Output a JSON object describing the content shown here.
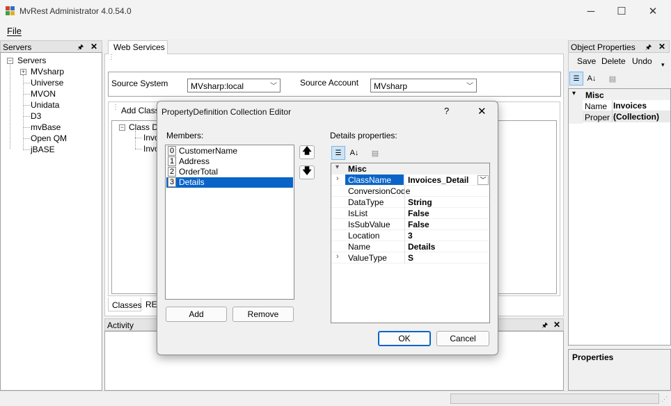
{
  "window": {
    "title": "MvRest Administrator 4.0.54.0"
  },
  "menu": {
    "file_label": "File"
  },
  "servers_panel": {
    "title": "Servers",
    "root": "Servers",
    "items": [
      "MVsharp",
      "Universe",
      "MVON",
      "Unidata",
      "D3",
      "mvBase",
      "Open QM",
      "jBASE"
    ]
  },
  "center": {
    "tab_label": "Web Services",
    "source_system_label": "Source System",
    "source_system_value": "MVsharp:local",
    "source_account_label": "Source Account",
    "source_account_value": "MVsharp",
    "add_class_label": "Add Class",
    "tree_root": "Class De",
    "tree_child_1": "Invo",
    "tree_child_2": "Invo",
    "bottom_tab_1": "Classes",
    "bottom_tab_2": "RE"
  },
  "activity_panel": {
    "title": "Activity"
  },
  "object_properties": {
    "title": "Object Properties",
    "save_label": "Save",
    "delete_label": "Delete",
    "undo_label": "Undo",
    "category": "Misc",
    "rows": [
      {
        "key": "Name",
        "value": "Invoices"
      },
      {
        "key": "Properti",
        "value": "(Collection)"
      }
    ],
    "description_title": "Properties"
  },
  "dialog": {
    "title": "PropertyDefinition Collection Editor",
    "help_label": "?",
    "members_label": "Members:",
    "members": [
      {
        "index": "0",
        "name": "CustomerName"
      },
      {
        "index": "1",
        "name": "Address"
      },
      {
        "index": "2",
        "name": "OrderTotal"
      },
      {
        "index": "3",
        "name": "Details"
      }
    ],
    "selected_member_index": 3,
    "details_label": "Details properties:",
    "category": "Misc",
    "properties": [
      {
        "key": "ClassName",
        "value": "Invoices_Detail",
        "expandable": true,
        "selected": true
      },
      {
        "key": "ConversionCode",
        "value": ""
      },
      {
        "key": "DataType",
        "value": "String"
      },
      {
        "key": "IsList",
        "value": "False"
      },
      {
        "key": "IsSubValue",
        "value": "False"
      },
      {
        "key": "Location",
        "value": "3"
      },
      {
        "key": "Name",
        "value": "Details"
      },
      {
        "key": "ValueType",
        "value": "S",
        "expandable": true
      }
    ],
    "add_label": "Add",
    "remove_label": "Remove",
    "ok_label": "OK",
    "cancel_label": "Cancel"
  },
  "colors": {
    "selection": "#0a64c8",
    "panel_header": "#e5e5e5"
  }
}
